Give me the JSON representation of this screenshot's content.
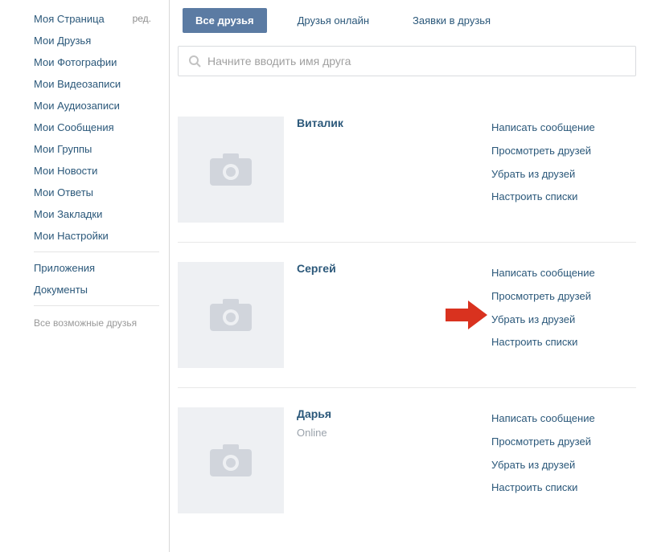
{
  "sidebar": {
    "items": [
      {
        "label": "Моя Страница",
        "edit": "ред."
      },
      {
        "label": "Мои Друзья"
      },
      {
        "label": "Мои Фотографии"
      },
      {
        "label": "Мои Видеозаписи"
      },
      {
        "label": "Мои Аудиозаписи"
      },
      {
        "label": "Мои Сообщения"
      },
      {
        "label": "Мои Группы"
      },
      {
        "label": "Мои Новости"
      },
      {
        "label": "Мои Ответы"
      },
      {
        "label": "Мои Закладки"
      },
      {
        "label": "Мои Настройки"
      }
    ],
    "items2": [
      {
        "label": "Приложения"
      },
      {
        "label": "Документы"
      }
    ],
    "all_possible": "Все возможные друзья"
  },
  "tabs": {
    "all": "Все друзья",
    "online": "Друзья онлайн",
    "requests": "Заявки в друзья"
  },
  "search": {
    "placeholder": "Начните вводить имя друга"
  },
  "action_labels": {
    "write": "Написать сообщение",
    "view": "Просмотреть друзей",
    "remove": "Убрать из друзей",
    "lists": "Настроить списки"
  },
  "friends": [
    {
      "name": "Виталик",
      "status": ""
    },
    {
      "name": "Сергей",
      "status": "",
      "arrow": true
    },
    {
      "name": "Дарья",
      "status": "Online"
    }
  ]
}
